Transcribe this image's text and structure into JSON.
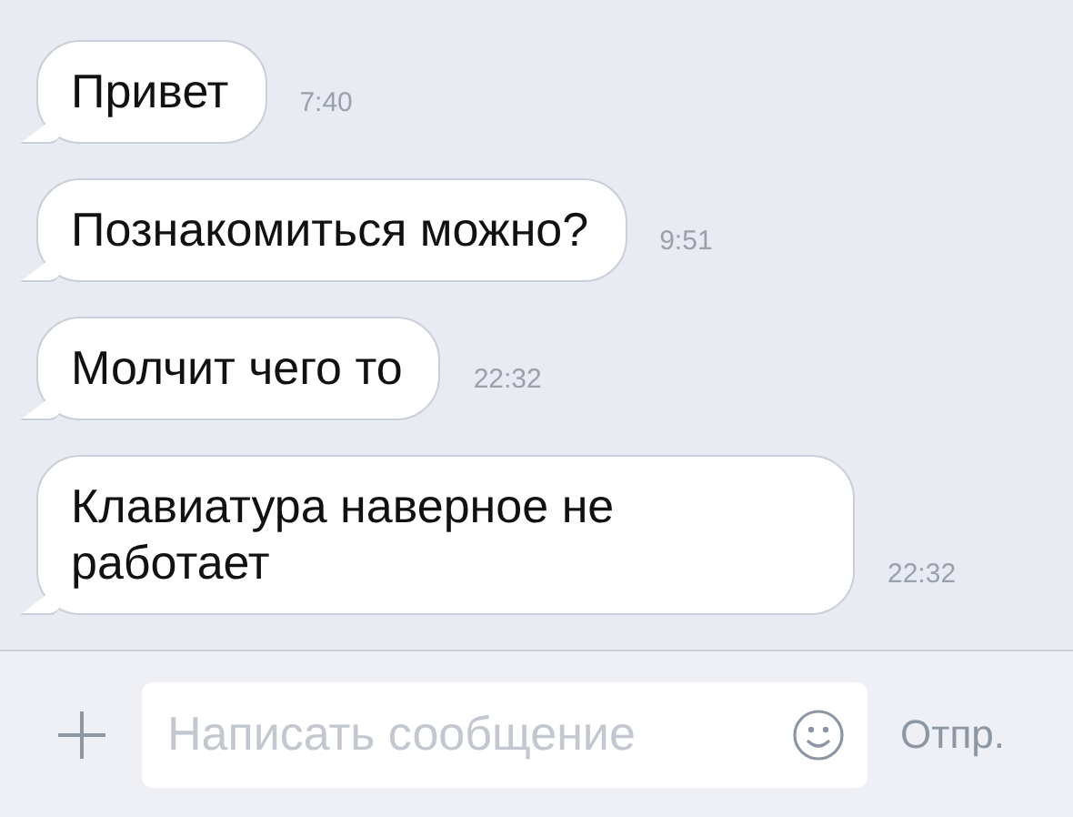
{
  "messages": [
    {
      "text": "Привет",
      "time": "7:40"
    },
    {
      "text": "Познакомиться можно?",
      "time": "9:51"
    },
    {
      "text": "Молчит чего то",
      "time": "22:32"
    },
    {
      "text": "Клавиатура наверное не работает",
      "time": "22:32"
    }
  ],
  "composer": {
    "placeholder": "Написать сообщение",
    "send": "Отпр."
  }
}
